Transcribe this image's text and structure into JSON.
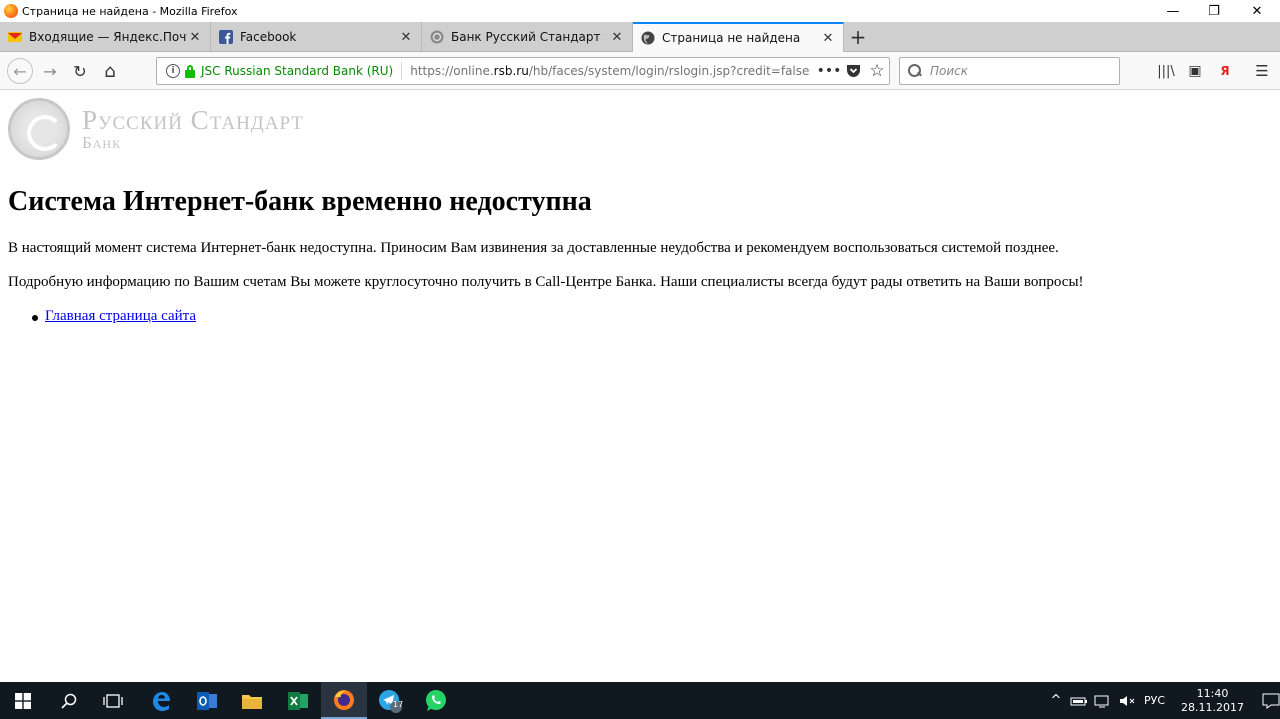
{
  "window": {
    "title": "Страница не найдена - Mozilla Firefox",
    "minimize": "—",
    "restore": "❐",
    "close": "✕"
  },
  "tabs": [
    {
      "label": "Входящие — Яндекс.Почта",
      "icon": "yandex-mail-icon",
      "close": "✕"
    },
    {
      "label": "Facebook",
      "icon": "facebook-icon",
      "close": "✕"
    },
    {
      "label": "Банк Русский Стандарт",
      "icon": "rsb-bank-icon",
      "close": "✕"
    },
    {
      "label": "Страница не найдена",
      "icon": "globe-icon",
      "close": "✕",
      "active": true
    }
  ],
  "new_tab": "+",
  "nav": {
    "back": "←",
    "forward": "→",
    "reload": "↻",
    "home": "⌂"
  },
  "urlbar": {
    "info": "i",
    "identity": "JSC Russian Standard Bank (RU)",
    "url_prefix": "https://online.",
    "url_domain": "rsb.ru",
    "url_suffix": "/hb/faces/system/login/rslogin.jsp?credit=false",
    "more": "•••",
    "pocket": "◆",
    "bookmark": "☆"
  },
  "search": {
    "placeholder": "Поиск"
  },
  "toolbar_right": {
    "library": "|||\\",
    "sidebar": "▣",
    "yandex": "Я",
    "menu": "☰"
  },
  "page": {
    "logo_name": "Русский Стандарт",
    "logo_sub": "Банк",
    "heading": "Система Интернет-банк временно недоступна",
    "paragraph1": "В настоящий момент система Интернет-банк недоступна. Приносим Вам извинения за доставленные неудобства и рекомендуем воспользоваться системой позднее.",
    "paragraph2": "Подробную информацию по Вашим счетам Вы можете круглосуточно получить в Call-Центре Банка. Наши специалисты всегда будут рады ответить на Ваши вопросы!",
    "link": "Главная страница сайта"
  },
  "taskbar": {
    "telegram_badge": "17",
    "tray": {
      "chevron": "^",
      "lang": "РУС",
      "time": "11:40",
      "date": "28.11.2017"
    }
  },
  "colors": {
    "tab_active_accent": "#0a84ff",
    "secure_green": "#058b00",
    "link": "#0000ee",
    "taskbar": "#101820"
  }
}
